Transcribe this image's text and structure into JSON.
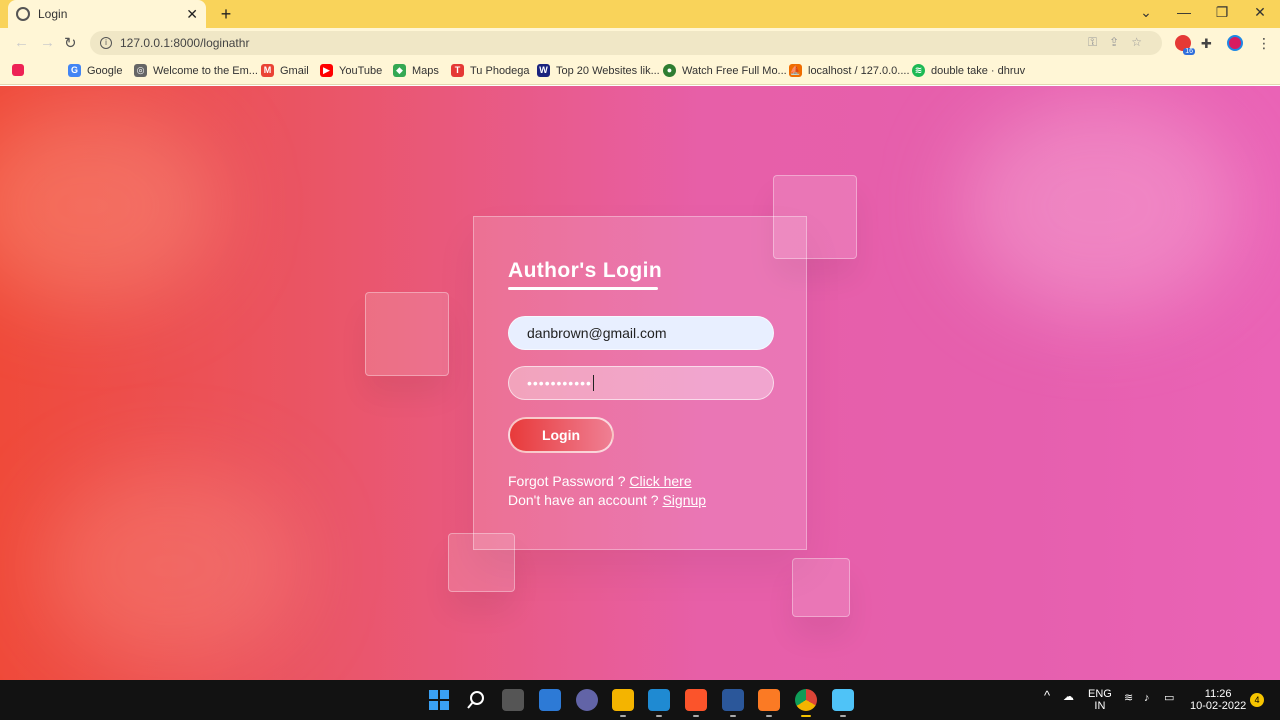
{
  "browser": {
    "tab_title": "Login",
    "tab_close": "✕",
    "new_tab": "+",
    "url": "127.0.0.1:8000/loginathr",
    "extension_badge": "16",
    "bookmarks": [
      {
        "label": "Google",
        "color": "#4285f4",
        "glyph": "G"
      },
      {
        "label": "Welcome to the Em...",
        "color": "#666666",
        "glyph": "◎"
      },
      {
        "label": "Gmail",
        "color": "#ea4335",
        "glyph": "M"
      },
      {
        "label": "YouTube",
        "color": "#ff0000",
        "glyph": "▶"
      },
      {
        "label": "Maps",
        "color": "#34a853",
        "glyph": "◆"
      },
      {
        "label": "Tu Phodega",
        "color": "#e53935",
        "glyph": "T"
      },
      {
        "label": "Top 20 Websites lik...",
        "color": "#1a237e",
        "glyph": "W"
      },
      {
        "label": "Watch Free Full Mo...",
        "color": "#2e7d32",
        "glyph": "●"
      },
      {
        "label": "localhost / 127.0.0....",
        "color": "#ef6c00",
        "glyph": "⛵"
      },
      {
        "label": "double take · dhruv",
        "color": "#1db954",
        "glyph": "≋"
      }
    ]
  },
  "login": {
    "title": "Author's Login",
    "email_value": "danbrown@gmail.com",
    "password_mask": "•••••••••••",
    "button_label": "Login",
    "forgot_text": "Forgot Password ? ",
    "forgot_link": "Click here",
    "signup_text": "Don't have an account ? ",
    "signup_link": "Signup"
  },
  "taskbar": {
    "lang_line1": "ENG",
    "lang_line2": "IN",
    "time": "11:26",
    "date": "10-02-2022",
    "notification_count": "4"
  },
  "colors": {
    "accent": "#e83a3a",
    "tab_bar": "#f9d35a"
  }
}
